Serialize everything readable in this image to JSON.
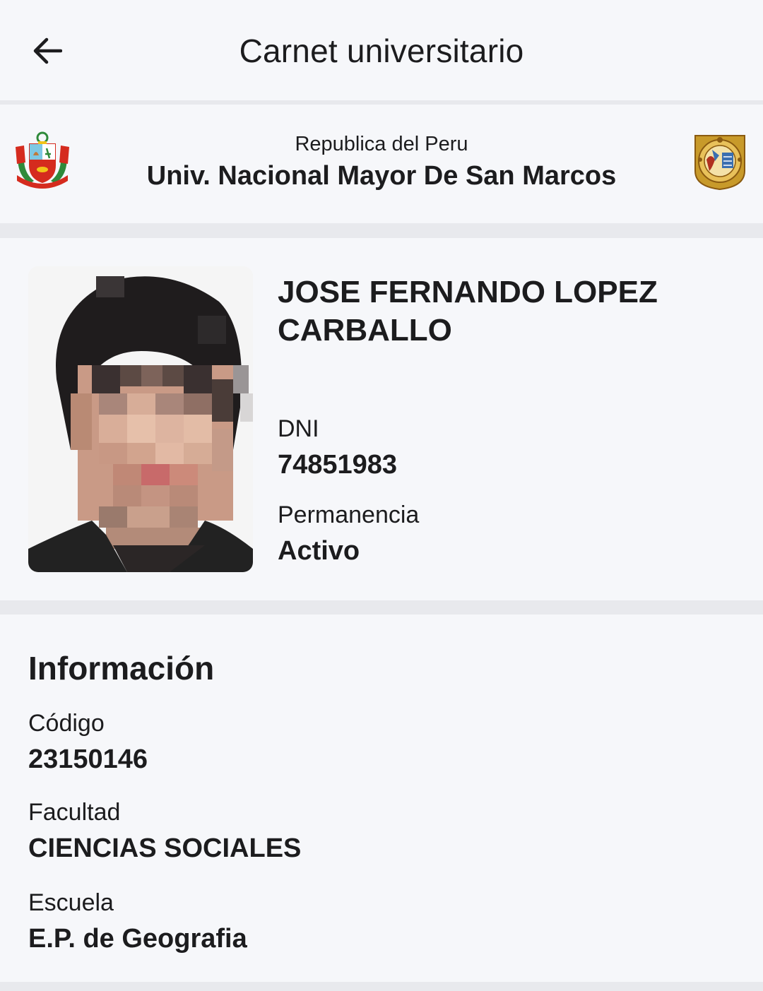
{
  "topbar": {
    "title": "Carnet universitario",
    "back_icon": "arrow-left-icon"
  },
  "header": {
    "country": "Republica del Peru",
    "university": "Univ. Nacional Mayor De San Marcos",
    "left_emblem": "peru-coat-of-arms-icon",
    "right_emblem": "unmsm-seal-icon"
  },
  "profile": {
    "name": "JOSE FERNANDO LOPEZ CARBALLO",
    "dni_label": "DNI",
    "dni_value": "74851983",
    "permanencia_label": "Permanencia",
    "permanencia_value": "Activo"
  },
  "info": {
    "title": "Información",
    "codigo_label": "Código",
    "codigo_value": "23150146",
    "facultad_label": "Facultad",
    "facultad_value": "CIENCIAS SOCIALES",
    "escuela_label": "Escuela",
    "escuela_value": "E.P. de Geografia"
  },
  "colors": {
    "surface": "#f6f7fa",
    "divider": "#e8e9ed",
    "text": "#1c1c1e",
    "peru_red": "#d52b1e",
    "seal_gold": "#c89a2a"
  }
}
